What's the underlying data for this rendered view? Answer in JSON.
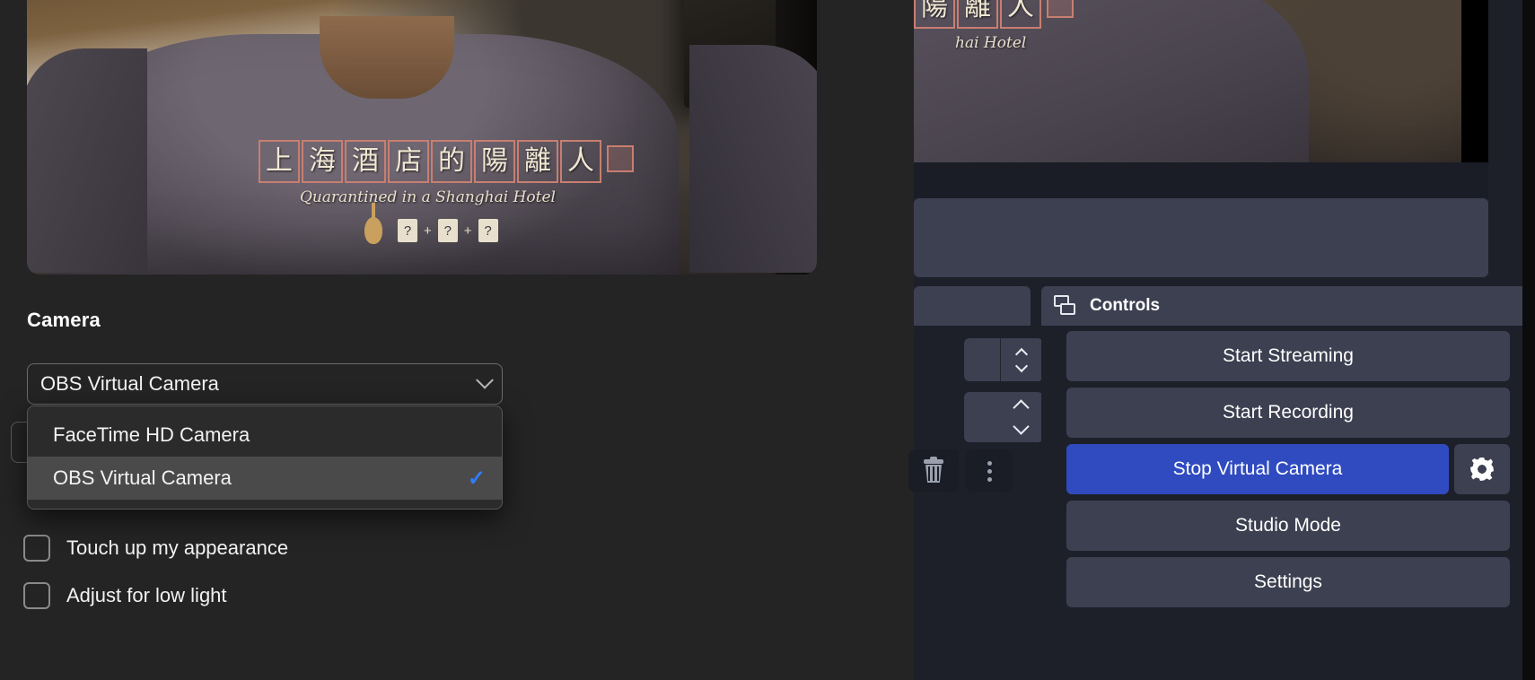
{
  "zoom_settings": {
    "video_preview": {
      "shirt_title_chars": [
        "上",
        "海",
        "酒",
        "店",
        "的",
        "陽",
        "離",
        "人"
      ],
      "shirt_subtitle": "Quarantined in a Shanghai Hotel",
      "shirt_tiles": [
        "?",
        "?",
        "?"
      ],
      "plus": "+"
    },
    "camera_section_label": "Camera",
    "camera_select": {
      "value": "OBS Virtual Camera",
      "chevron_icon": "chevron-down-icon"
    },
    "camera_menu": {
      "items": [
        {
          "label": "FaceTime HD Camera",
          "selected": false,
          "check": ""
        },
        {
          "label": "OBS Virtual Camera",
          "selected": true,
          "check": "✓"
        }
      ]
    },
    "checkboxes": [
      {
        "label": "Touch up my appearance",
        "checked": false
      },
      {
        "label": "Adjust for low light",
        "checked": false
      }
    ]
  },
  "obs": {
    "preview": {
      "shirt_title_chars": [
        "陽",
        "離",
        "人"
      ],
      "shirt_subtitle": "hai Hotel"
    },
    "controls_dock": {
      "title": "Controls",
      "icon": "panes-icon",
      "buttons": [
        {
          "label": "Start Streaming",
          "style": "normal"
        },
        {
          "label": "Start Recording",
          "style": "normal"
        },
        {
          "label": "Stop Virtual Camera",
          "style": "primary"
        },
        {
          "label": "Studio Mode",
          "style": "normal"
        },
        {
          "label": "Settings",
          "style": "normal"
        }
      ],
      "gear_icon": "gear-icon"
    },
    "side_widgets": {
      "trash_icon": "trash-icon",
      "more_icon": "more-vertical-icon",
      "stepper_up_icon": "caret-up-icon",
      "stepper_down_icon": "caret-down-icon"
    }
  },
  "colors": {
    "accent_blue": "#2f4bbf",
    "check_blue": "#2f7cf6",
    "obs_bg": "#1e2029",
    "obs_panel": "#3c4050",
    "zoom_bg": "#242424"
  }
}
